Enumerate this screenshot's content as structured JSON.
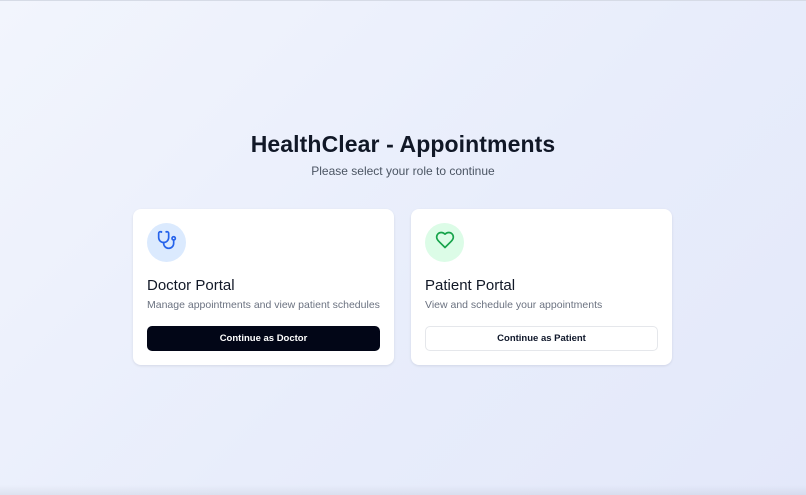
{
  "header": {
    "title": "HealthClear - Appointments",
    "subtitle": "Please select your role to continue"
  },
  "cards": [
    {
      "id": "doctor",
      "icon": "stethoscope-icon",
      "icon_color": "#2563eb",
      "icon_bg": "#dbeafe",
      "title": "Doctor Portal",
      "description": "Manage appointments and view patient schedules",
      "button_label": "Continue as Doctor",
      "button_style": "dark"
    },
    {
      "id": "patient",
      "icon": "heart-icon",
      "icon_color": "#16a34a",
      "icon_bg": "#dcfce7",
      "title": "Patient Portal",
      "description": "View and schedule your appointments",
      "button_label": "Continue as Patient",
      "button_style": "light"
    }
  ],
  "colors": {
    "primary_button": "#020617",
    "background": "#eef1fc"
  }
}
